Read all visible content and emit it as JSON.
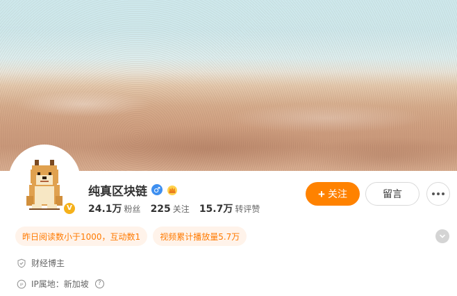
{
  "profile": {
    "nickname": "纯真区块链",
    "gender_icon": "male-icon",
    "level_icon": "crown-icon",
    "verified_badge_icon": "verified-v-icon",
    "verified_badge_label": "V",
    "avatar_icon": "doge-pixel-avatar"
  },
  "stats": [
    {
      "value": "24.1万",
      "label": "粉丝"
    },
    {
      "value": "225",
      "label": "关注"
    },
    {
      "value": "15.7万",
      "label": "转评赞"
    }
  ],
  "actions": {
    "follow_label": "关注",
    "follow_icon": "plus-icon",
    "message_label": "留言",
    "more_icon": "more-dots-icon"
  },
  "tags": [
    "昨日阅读数小于1000，互动数1",
    "视频累计播放量5.7万"
  ],
  "info": {
    "category": "财经博主",
    "category_icon": "shield-icon",
    "ip_label": "IP属地：新加坡",
    "ip_icon": "ip-icon",
    "help_icon": "question-icon",
    "expand_icon": "chevron-down-icon"
  },
  "colors": {
    "accent": "#ff8200",
    "tag_bg": "#fff3ea",
    "tag_text": "#ff7a00",
    "male": "#3e8ff0",
    "verified": "#f5b11b"
  }
}
